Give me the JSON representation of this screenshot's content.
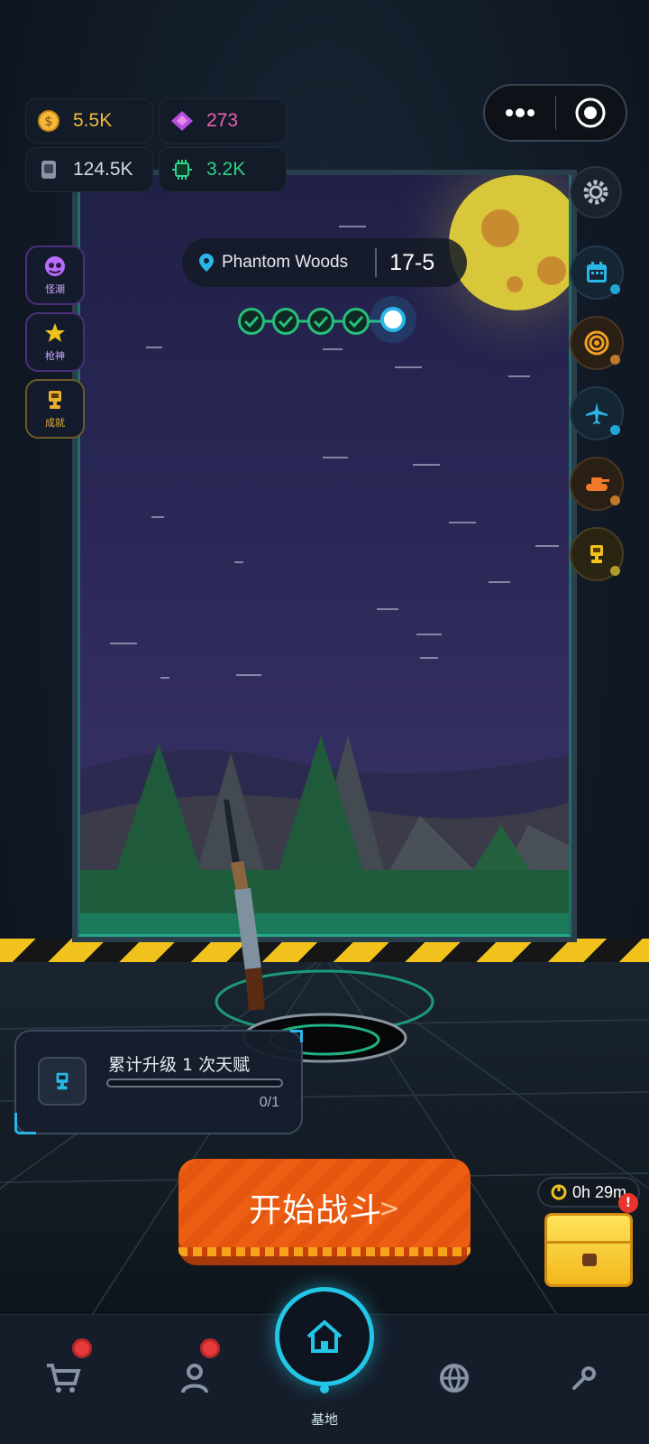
{
  "resources": {
    "coins": {
      "value": "5.5K",
      "icon": "coin-icon",
      "color": "#f4b83a"
    },
    "gems": {
      "value": "273",
      "icon": "gem-icon",
      "color": "#f05fb0"
    },
    "cards": {
      "value": "124.5K",
      "icon": "card-icon",
      "color": "#d4dae4"
    },
    "chips": {
      "value": "3.2K",
      "icon": "chip-icon",
      "color": "#2fd38a"
    }
  },
  "left_buttons": [
    {
      "label": "怪潮",
      "icon": "monster-icon",
      "color": "#b96cff"
    },
    {
      "label": "枪神",
      "icon": "star-icon",
      "color": "#b96cff"
    },
    {
      "label": "成就",
      "icon": "trophy-icon",
      "color": "#e8b02a"
    }
  ],
  "right_buttons": [
    {
      "icon": "calendar-icon",
      "dot_color": "#22a6d8"
    },
    {
      "icon": "target-icon",
      "dot_color": "#c07a2a"
    },
    {
      "icon": "plane-icon",
      "dot_color": "#22a6d8"
    },
    {
      "icon": "tank-icon",
      "dot_color": "#c07a2a"
    },
    {
      "icon": "trophy-icon",
      "dot_color": "#b09a2a"
    }
  ],
  "stage": {
    "location": "Phantom Woods",
    "level": "17-5",
    "completed_waves": 4,
    "total_waves": 5
  },
  "quest": {
    "title": "累计升级 1 次天赋",
    "progress_text": "0/1",
    "progress": 0
  },
  "start_button": {
    "label": "开始战斗",
    "arrow": ">"
  },
  "chest": {
    "timer": "0h 29m",
    "badge": "!"
  },
  "nav": {
    "home_label": "基地",
    "items": [
      "shop-cart-icon",
      "profile-icon",
      "home-icon",
      "globe-icon",
      "wrench-icon"
    ]
  },
  "colors": {
    "accent": "#22c7e8",
    "start": "#ee5e12",
    "hazard_yellow": "#f1c21b"
  }
}
